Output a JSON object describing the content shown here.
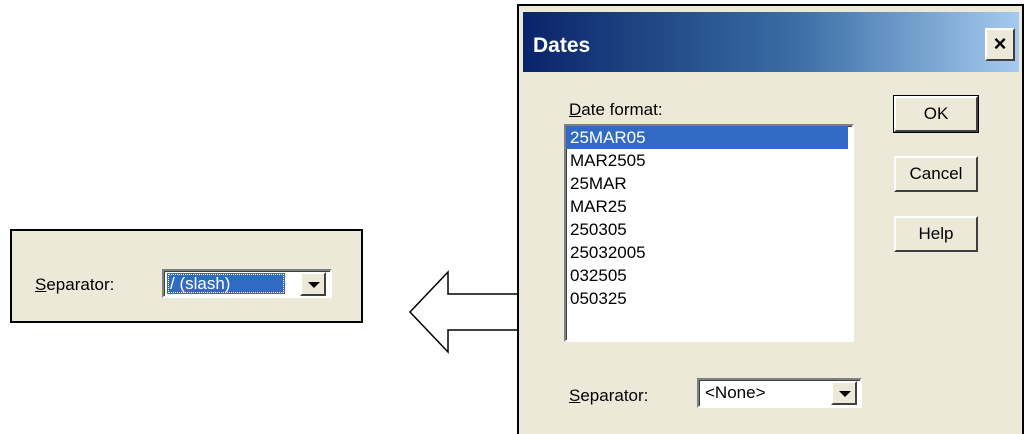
{
  "callout": {
    "separator_label": "Separator:",
    "separator_accel": "S",
    "separator_rest": "eparator:",
    "separator_value": "/ (slash)"
  },
  "dialog": {
    "title": "Dates",
    "close_label": "×",
    "date_format_accel": "D",
    "date_format_rest": "ate format:",
    "date_formats": [
      "25MAR05",
      "MAR2505",
      "25MAR",
      "MAR25",
      "250305",
      "25032005",
      "032505",
      "050325"
    ],
    "selected_index": 0,
    "buttons": {
      "ok": "OK",
      "cancel": "Cancel",
      "help": "Help"
    },
    "separator_accel": "S",
    "separator_rest": "eparator:",
    "separator_value": "<None>"
  },
  "icons": {
    "arrow": "arrow-left-icon",
    "dropdown": "chevron-down-icon",
    "close": "close-icon"
  },
  "colors": {
    "dialog_bg": "#ece9d8",
    "selection": "#316ac5",
    "title_start": "#0a246a",
    "title_end": "#a6caf0"
  }
}
